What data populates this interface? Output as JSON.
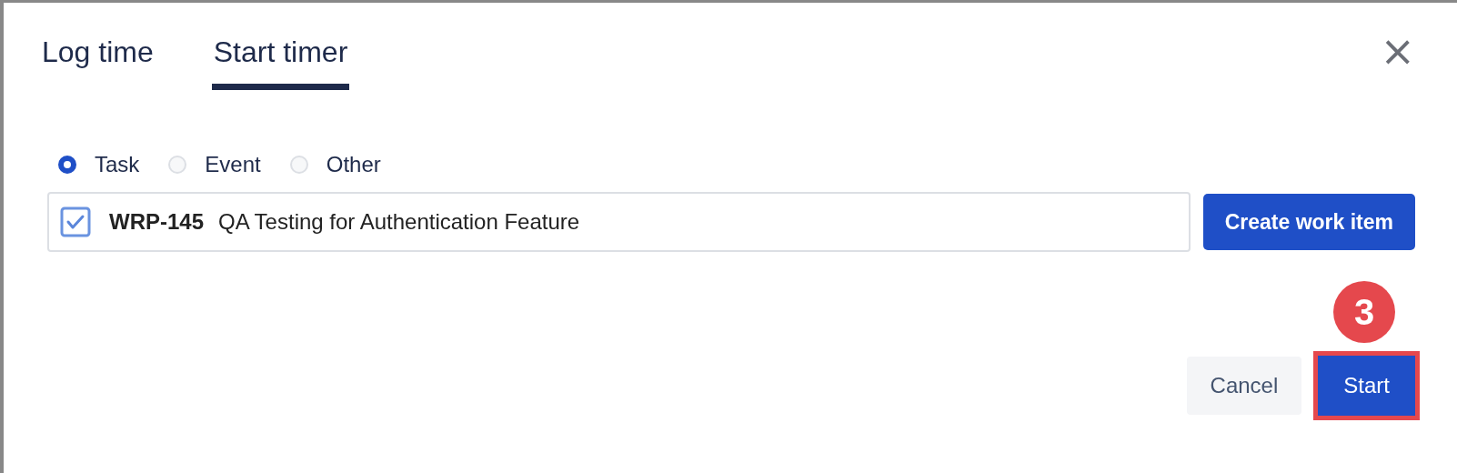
{
  "tabs": [
    {
      "label": "Log time",
      "selected": false
    },
    {
      "label": "Start timer",
      "selected": true
    }
  ],
  "close": "×",
  "entry_types": [
    {
      "label": "Task",
      "selected": true
    },
    {
      "label": "Event",
      "selected": false
    },
    {
      "label": "Other",
      "selected": false
    }
  ],
  "work_item": {
    "checked": true,
    "key": "WRP-145",
    "title": "QA Testing for Authentication Feature"
  },
  "create_button": "Create work item",
  "step_badge": "3",
  "buttons": [
    {
      "label": "Cancel",
      "kind": "secondary",
      "highlighted": false
    },
    {
      "label": "Start",
      "kind": "primary",
      "highlighted": true
    }
  ]
}
